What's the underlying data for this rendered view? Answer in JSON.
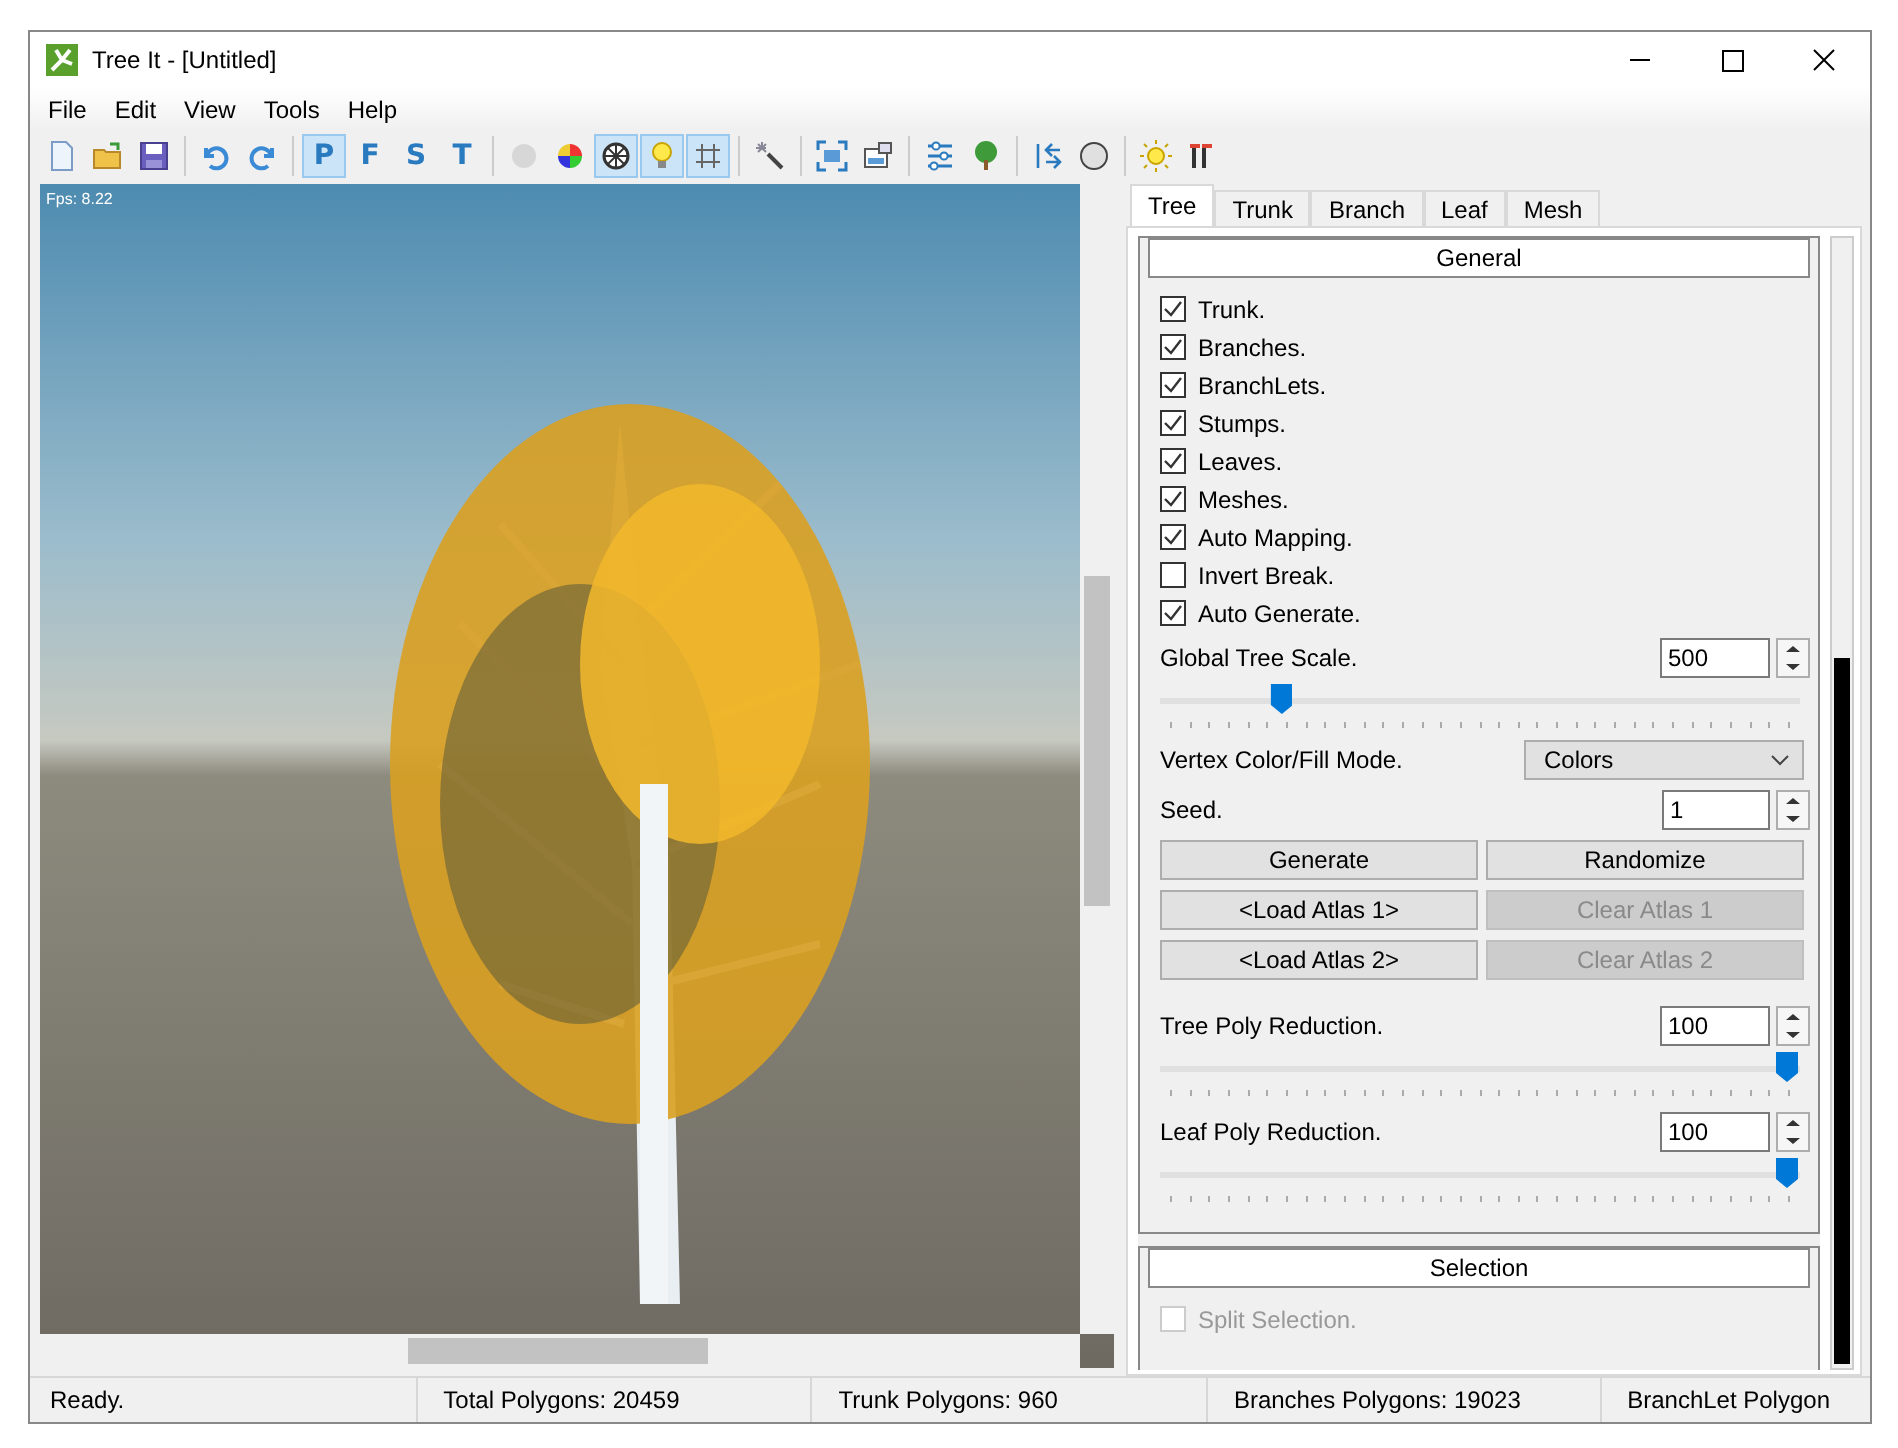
{
  "window": {
    "title": "Tree It - [Untitled]"
  },
  "menu": [
    "File",
    "Edit",
    "View",
    "Tools",
    "Help"
  ],
  "toolbar_groups": [
    {
      "items": [
        {
          "selected": false,
          "disabled": false
        },
        {
          "selected": false,
          "disabled": false
        },
        {
          "selected": false,
          "disabled": false
        }
      ]
    },
    {
      "items": [
        {
          "selected": false,
          "disabled": false
        },
        {
          "selected": false,
          "disabled": false
        }
      ]
    },
    {
      "items": [
        {
          "label": "P",
          "selected": true,
          "disabled": false
        },
        {
          "label": "F",
          "selected": false,
          "disabled": false
        },
        {
          "label": "S",
          "selected": false,
          "disabled": false
        },
        {
          "label": "T",
          "selected": false,
          "disabled": false
        }
      ]
    },
    {
      "items": [
        {
          "selected": false,
          "disabled": true
        },
        {
          "selected": false,
          "disabled": false
        },
        {
          "selected": true,
          "disabled": false
        },
        {
          "selected": true,
          "disabled": false
        },
        {
          "selected": true,
          "disabled": false
        }
      ]
    },
    {
      "items": [
        {
          "selected": false,
          "disabled": false
        }
      ]
    },
    {
      "items": [
        {
          "selected": false,
          "disabled": false
        },
        {
          "selected": false,
          "disabled": false
        }
      ]
    },
    {
      "items": [
        {
          "selected": false,
          "disabled": false
        },
        {
          "selected": false,
          "disabled": false
        }
      ]
    },
    {
      "items": [
        {
          "selected": false,
          "disabled": false
        },
        {
          "selected": false,
          "disabled": false
        }
      ]
    },
    {
      "items": [
        {
          "selected": false,
          "disabled": false
        },
        {
          "selected": false,
          "disabled": false
        }
      ]
    }
  ],
  "viewport": {
    "fps": "Fps: 8.22"
  },
  "tabs": [
    {
      "label": "Tree",
      "selected": true
    },
    {
      "label": "Trunk",
      "selected": false
    },
    {
      "label": "Branch",
      "selected": false
    },
    {
      "label": "Leaf",
      "selected": false
    },
    {
      "label": "Mesh",
      "selected": false
    }
  ],
  "general": {
    "title": "General",
    "checkboxes": [
      {
        "label": "Trunk.",
        "checked": true,
        "disabled": false
      },
      {
        "label": "Branches.",
        "checked": true,
        "disabled": false
      },
      {
        "label": "BranchLets.",
        "checked": true,
        "disabled": false
      },
      {
        "label": "Stumps.",
        "checked": true,
        "disabled": false
      },
      {
        "label": "Leaves.",
        "checked": true,
        "disabled": false
      },
      {
        "label": "Meshes.",
        "checked": true,
        "disabled": false
      },
      {
        "label": "Auto Mapping.",
        "checked": true,
        "disabled": false
      },
      {
        "label": "Invert Break.",
        "checked": false,
        "disabled": false
      },
      {
        "label": "Auto Generate.",
        "checked": true,
        "disabled": false
      }
    ],
    "scale": {
      "label": "Global Tree Scale.",
      "value": "500",
      "level": 0.18
    },
    "fill_mode": {
      "label": "Vertex Color/Fill Mode.",
      "value": "Colors"
    },
    "seed": {
      "label": "Seed.",
      "value": "1"
    },
    "buttons": [
      {
        "label": "Generate",
        "disabled": false
      },
      {
        "label": "Randomize",
        "disabled": false
      },
      {
        "label": "<Load Atlas 1>",
        "disabled": false
      },
      {
        "label": "Clear Atlas 1",
        "disabled": true
      },
      {
        "label": "<Load Atlas 2>",
        "disabled": false
      },
      {
        "label": "Clear Atlas 2",
        "disabled": true
      }
    ],
    "reductions": [
      {
        "label": "Tree Poly Reduction.",
        "value": "100",
        "level": 1
      },
      {
        "label": "Leaf Poly Reduction.",
        "value": "100",
        "level": 1
      }
    ]
  },
  "selection": {
    "title": "Selection",
    "checkboxes": [
      {
        "label": "Split Selection.",
        "checked": false,
        "disabled": true
      }
    ]
  },
  "status_bar": [
    "Ready.",
    "Total Polygons: 20459",
    "Trunk Polygons: 960",
    "Branches Polygons: 19023",
    "BranchLet Polygon"
  ]
}
